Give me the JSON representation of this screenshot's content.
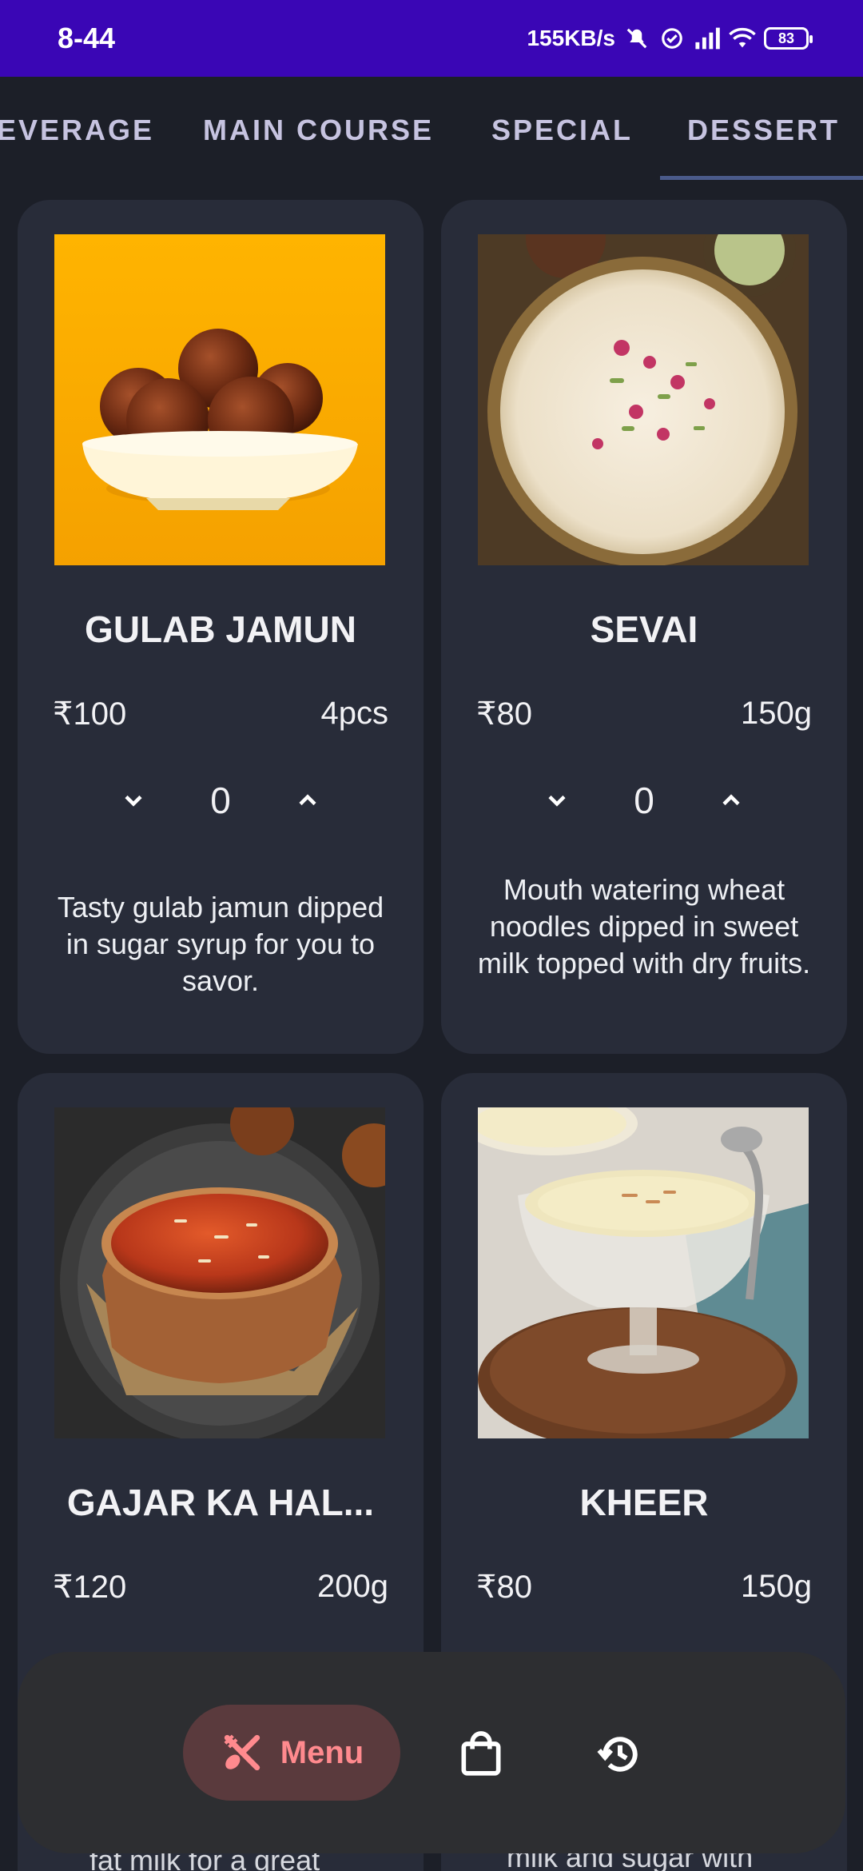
{
  "status_bar": {
    "time": "8-44",
    "network_speed": "155KB/s",
    "battery": "83",
    "icons": [
      "mute-icon",
      "vpn-icon",
      "signal-icon",
      "wifi-icon",
      "battery-icon"
    ]
  },
  "tabs": {
    "items": [
      {
        "label": "EVERAGE"
      },
      {
        "label": "MAIN COURSE"
      },
      {
        "label": "SPECIAL"
      },
      {
        "label": "DESSERT"
      }
    ],
    "selected": "DESSERT"
  },
  "cards": [
    {
      "name": "GULAB JAMUN",
      "price": "₹100",
      "quantity": "4pcs",
      "count": "0",
      "description": "Tasty gulab jamun dipped in sugar syrup for you to savor."
    },
    {
      "name": "SEVAI",
      "price": "₹80",
      "quantity": "150g",
      "count": "0",
      "description": "Mouth watering wheat noodles dipped in sweet milk topped with dry fruits."
    },
    {
      "name": "GAJAR KA HAL...",
      "price": "₹120",
      "quantity": "200g"
    },
    {
      "name": "KHEER",
      "price": "₹80",
      "quantity": "150g"
    }
  ],
  "peek_text": {
    "left": "fat milk for a great",
    "right": "milk and sugar with"
  },
  "bottom_nav": {
    "menu_label": "Menu",
    "icons": [
      "cutlery-icon",
      "shopping-bag-icon",
      "history-icon"
    ]
  },
  "colors": {
    "status_bar": "#3a06b5",
    "background": "#1c1f28",
    "card": "#282c39",
    "accent": "#ff8a8e",
    "nav_pill": "#5a3a3d"
  }
}
